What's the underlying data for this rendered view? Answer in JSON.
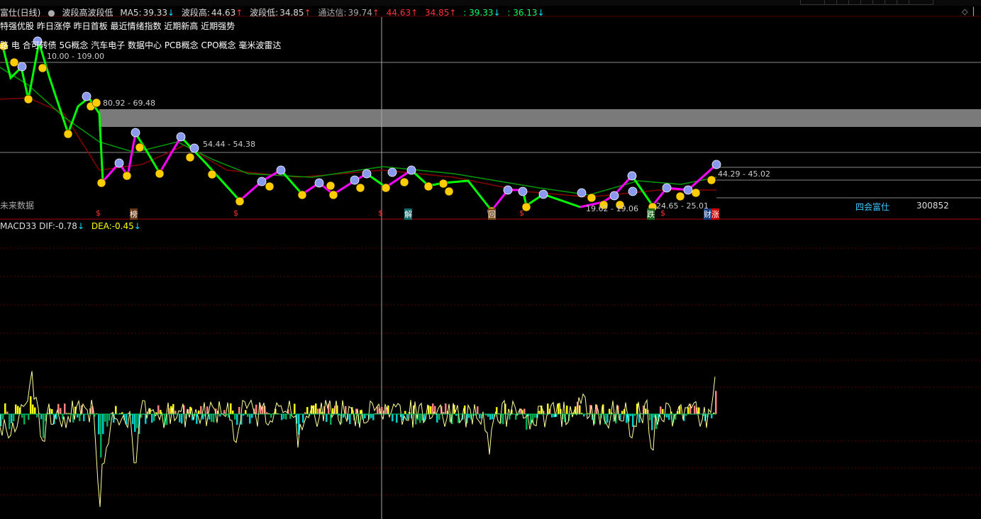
{
  "header": {
    "title": "富仕(日线)",
    "indicator_name": "波段高波段低",
    "ma5_label": "MA5:",
    "ma5_value": "39.33",
    "wave_high_label": "波段高:",
    "wave_high_value": "44.63",
    "wave_low_label": "波段低:",
    "wave_low_value": "34.85",
    "channel_label": "通达信:",
    "channel_value": "39.74",
    "v1": "44.63",
    "v2": "34.85",
    "v3": ": 39.33",
    "v4": ": 36.13"
  },
  "tags": {
    "line1": "特强优股  昨日涨停  昨日首板  最近情绪指数  近期新高  近期强势",
    "line2": "路  电  合可转债  5G概念  汽车电子  数据中心  PCB概念  CPO概念  毫米波雷达"
  },
  "levels": {
    "l1": "10.00 - 109.00",
    "l2": "80.92 - 69.48",
    "l3": "54.44 - 54.38",
    "l4": "44.29 - 45.02",
    "l5": "19.62 - 19.06",
    "l6": "24.65 - 25.01"
  },
  "markers": {
    "s": "$",
    "bang": "榜",
    "jie": "解",
    "hui": "回",
    "die": "跌",
    "zhang": "涨",
    "cai": "财"
  },
  "future_label": "未来数据",
  "stock": {
    "name": "四会富仕",
    "code": "300852"
  },
  "macd": {
    "name": "MACD33",
    "dif_label": "DIF:",
    "dif_value": "-0.78",
    "dea_label": "DEA:",
    "dea_value": "-0.45"
  },
  "colors": {
    "up": "#ff3333",
    "down": "#00e5ff",
    "wave_green": "#00ff00",
    "wave_magenta": "#ff00ff",
    "ma_green": "#009900",
    "ma_red": "#cc0000",
    "macd_yellow": "#ffff00",
    "macd_pink": "#ff8080",
    "macd_cyan": "#00cccc"
  }
}
